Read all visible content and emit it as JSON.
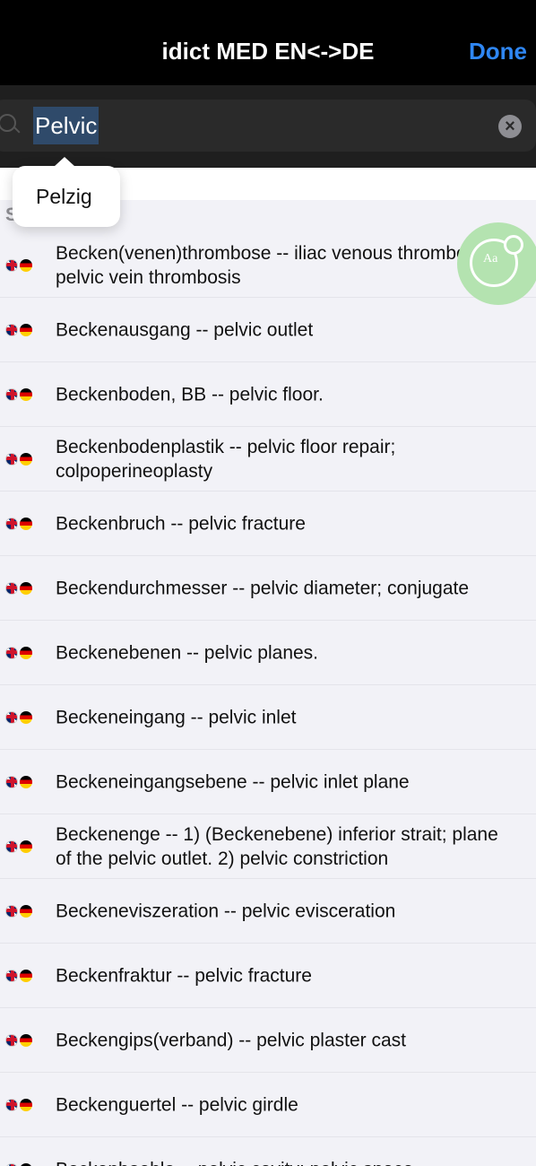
{
  "nav": {
    "title": "idict MED EN<->DE",
    "done_label": "Done"
  },
  "search": {
    "value": "Pelvic"
  },
  "suggestion": {
    "text": "Pelzig"
  },
  "section": {
    "header": "S      ults"
  },
  "results": [
    {
      "text": "Becken(venen)thrombose -- iliac venous thrombosis; pelvic vein thrombosis"
    },
    {
      "text": "Beckenausgang -- pelvic outlet"
    },
    {
      "text": "Beckenboden, BB -- pelvic floor."
    },
    {
      "text": "Beckenbodenplastik -- pelvic floor repair; colpoperineoplasty"
    },
    {
      "text": "Beckenbruch -- pelvic fracture"
    },
    {
      "text": "Beckendurchmesser -- pelvic diameter; conjugate"
    },
    {
      "text": "Beckenebenen -- pelvic planes."
    },
    {
      "text": "Beckeneingang -- pelvic inlet"
    },
    {
      "text": "Beckeneingangsebene -- pelvic inlet plane"
    },
    {
      "text": "Beckenenge -- 1) (Beckenebene) inferior strait; plane of the pelvic outlet. 2) pelvic constriction"
    },
    {
      "text": "Beckeneviszeration -- pelvic evisceration"
    },
    {
      "text": "Beckenfraktur -- pelvic fracture"
    },
    {
      "text": "Beckengips(verband) -- pelvic plaster cast"
    },
    {
      "text": "Beckenguertel -- pelvic girdle"
    },
    {
      "text": "Beckenhoehle -- pelvic cavity; pelvic space"
    }
  ],
  "colors": {
    "accent": "#2f87f5",
    "nav_background": "#000000",
    "fab_background": "#b4e3b0"
  }
}
